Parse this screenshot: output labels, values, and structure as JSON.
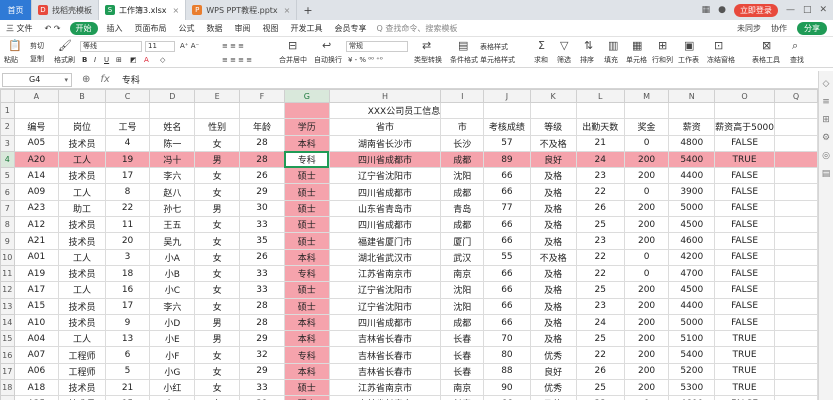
{
  "tabs": {
    "home": "首页",
    "items": [
      {
        "label": "找稻壳模板",
        "icon": "D",
        "color": "#e8493c"
      },
      {
        "label": "工作簿3.xlsx",
        "icon": "S",
        "color": "#1f9b56"
      },
      {
        "label": "WPS PPT教程.pptx",
        "icon": "P",
        "color": "#e97d2e"
      }
    ],
    "plus": "+",
    "login": "立即登录"
  },
  "menu": {
    "file": "三 文件",
    "items": [
      "开始",
      "插入",
      "页面布局",
      "公式",
      "数据",
      "审阅",
      "视图",
      "开发工具",
      "会员专享"
    ],
    "search": "Q 查找命令、搜索模板",
    "right": [
      "未同步",
      "协作",
      "分享"
    ]
  },
  "toolbar": {
    "paste": "粘贴",
    "cut": "剪切",
    "copy": "复制",
    "format_painter": "格式刷",
    "font_name": "等线",
    "font_size": "11",
    "number_format": "常规",
    "merge_center": "合并居中",
    "auto_wrap": "自动换行",
    "type_convert": "类型转换",
    "cond_format": "条件格式",
    "table_style": "表格样式",
    "cell_style": "单元格样式",
    "sum": "求和",
    "filter": "筛选",
    "sort": "排序",
    "fill": "填充",
    "cell": "单元格",
    "row_col": "行和列",
    "worksheet": "工作表",
    "freeze": "冻结窗格",
    "table_tools": "表格工具",
    "find": "查找"
  },
  "formula_bar": {
    "cell_ref": "G4",
    "fx": "fx",
    "value": "专科"
  },
  "sheet": {
    "columns": [
      "A",
      "B",
      "C",
      "D",
      "E",
      "F",
      "G",
      "H",
      "I",
      "J",
      "K",
      "L",
      "M",
      "N",
      "O",
      "Q"
    ],
    "title": "XXX公司员工信息",
    "rows": [
      [
        "编号",
        "岗位",
        "工号",
        "姓名",
        "性别",
        "年龄",
        "学历",
        "省市",
        "市",
        "考核成绩",
        "等级",
        "出勤天数",
        "奖金",
        "薪资",
        "薪资高于5000"
      ],
      [
        "A05",
        "技术员",
        "4",
        "陈一",
        "女",
        "28",
        "本科",
        "湖南省长沙市",
        "长沙",
        "57",
        "不及格",
        "21",
        "0",
        "4800",
        "FALSE"
      ],
      [
        "A20",
        "工人",
        "19",
        "冯十",
        "男",
        "28",
        "专科",
        "四川省成都市",
        "成都",
        "89",
        "良好",
        "24",
        "200",
        "5400",
        "TRUE"
      ],
      [
        "A14",
        "技术员",
        "17",
        "李六",
        "女",
        "26",
        "硕士",
        "辽宁省沈阳市",
        "沈阳",
        "66",
        "及格",
        "23",
        "200",
        "4400",
        "FALSE"
      ],
      [
        "A09",
        "工人",
        "8",
        "赵八",
        "女",
        "29",
        "硕士",
        "四川省成都市",
        "成都",
        "66",
        "及格",
        "22",
        "0",
        "3900",
        "FALSE"
      ],
      [
        "A23",
        "助工",
        "22",
        "孙七",
        "男",
        "30",
        "硕士",
        "山东省青岛市",
        "青岛",
        "77",
        "及格",
        "26",
        "200",
        "5000",
        "FALSE"
      ],
      [
        "A12",
        "技术员",
        "11",
        "王五",
        "女",
        "33",
        "硕士",
        "四川省成都市",
        "成都",
        "66",
        "及格",
        "25",
        "200",
        "4500",
        "FALSE"
      ],
      [
        "A21",
        "技术员",
        "20",
        "吴九",
        "女",
        "35",
        "硕士",
        "福建省厦门市",
        "厦门",
        "66",
        "及格",
        "23",
        "200",
        "4600",
        "FALSE"
      ],
      [
        "A01",
        "工人",
        "3",
        "小A",
        "女",
        "26",
        "本科",
        "湖北省武汉市",
        "武汉",
        "55",
        "不及格",
        "22",
        "0",
        "4200",
        "FALSE"
      ],
      [
        "A19",
        "技术员",
        "18",
        "小B",
        "女",
        "33",
        "专科",
        "江苏省南京市",
        "南京",
        "66",
        "及格",
        "22",
        "0",
        "4700",
        "FALSE"
      ],
      [
        "A17",
        "工人",
        "16",
        "小C",
        "女",
        "33",
        "硕士",
        "辽宁省沈阳市",
        "沈阳",
        "66",
        "及格",
        "25",
        "200",
        "4500",
        "FALSE"
      ],
      [
        "A15",
        "技术员",
        "17",
        "李六",
        "女",
        "28",
        "硕士",
        "辽宁省沈阳市",
        "沈阳",
        "66",
        "及格",
        "23",
        "200",
        "4400",
        "FALSE"
      ],
      [
        "A10",
        "技术员",
        "9",
        "小D",
        "男",
        "28",
        "本科",
        "四川省成都市",
        "成都",
        "66",
        "及格",
        "24",
        "200",
        "5000",
        "FALSE"
      ],
      [
        "A04",
        "工人",
        "13",
        "小E",
        "男",
        "29",
        "本科",
        "吉林省长春市",
        "长春",
        "70",
        "及格",
        "25",
        "200",
        "5100",
        "TRUE"
      ],
      [
        "A07",
        "工程师",
        "6",
        "小F",
        "女",
        "32",
        "专科",
        "吉林省长春市",
        "长春",
        "80",
        "优秀",
        "22",
        "200",
        "5400",
        "TRUE"
      ],
      [
        "A06",
        "工程师",
        "5",
        "小G",
        "女",
        "29",
        "本科",
        "吉林省长春市",
        "长春",
        "88",
        "良好",
        "26",
        "200",
        "5200",
        "TRUE"
      ],
      [
        "A18",
        "技术员",
        "21",
        "小红",
        "女",
        "33",
        "硕士",
        "江苏省南京市",
        "南京",
        "90",
        "优秀",
        "25",
        "200",
        "5300",
        "TRUE"
      ],
      [
        "A25",
        "技术员",
        "15",
        "小H",
        "女",
        "31",
        "硕士",
        "吉林省长春市",
        "长春",
        "66",
        "及格",
        "23",
        "0",
        "4600",
        "FALSE"
      ]
    ]
  },
  "sidebar": [
    "◇",
    "≡",
    "⊞",
    "⚙",
    "◎",
    "▤"
  ]
}
